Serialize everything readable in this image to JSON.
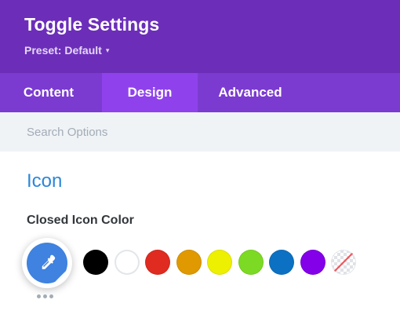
{
  "header": {
    "title": "Toggle Settings",
    "preset": "Preset: Default",
    "preset_caret": "▾",
    "bg_color": "#6c2eb9"
  },
  "tabs": [
    {
      "label": "Content",
      "active": false
    },
    {
      "label": "Design",
      "active": true
    },
    {
      "label": "Advanced",
      "active": false
    }
  ],
  "search": {
    "placeholder": "Search Options"
  },
  "section": {
    "title": "Icon",
    "color": "#2b87da"
  },
  "field": {
    "label": "Closed Icon Color",
    "picker_icon": "eyedropper-icon",
    "picker_color": "#3f82e0"
  },
  "swatches": [
    {
      "name": "black",
      "color": "#000000"
    },
    {
      "name": "white",
      "color": "#ffffff"
    },
    {
      "name": "red",
      "color": "#e02b20"
    },
    {
      "name": "orange",
      "color": "#e09900"
    },
    {
      "name": "yellow",
      "color": "#edf000"
    },
    {
      "name": "green",
      "color": "#7cda24"
    },
    {
      "name": "blue",
      "color": "#0c71c3"
    },
    {
      "name": "purple",
      "color": "#8300e9"
    },
    {
      "name": "none",
      "color": "transparent"
    }
  ],
  "more_icon": "ellipsis-icon"
}
